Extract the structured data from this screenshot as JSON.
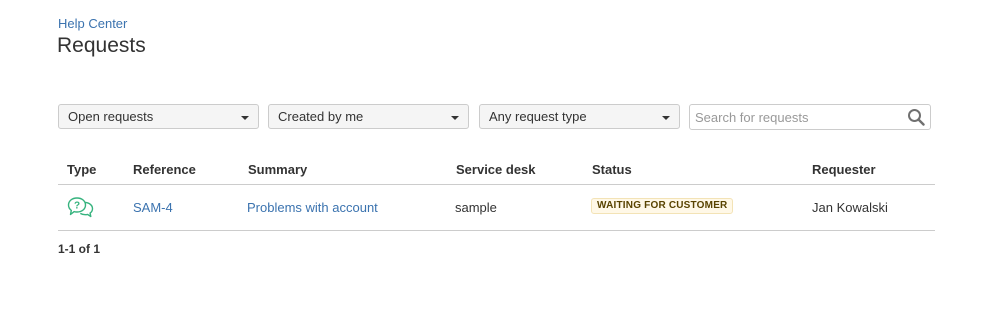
{
  "breadcrumb": {
    "label": "Help Center"
  },
  "page": {
    "title": "Requests"
  },
  "filters": {
    "status": {
      "value": "Open requests"
    },
    "created_by": {
      "value": "Created by me"
    },
    "request_type": {
      "value": "Any request type"
    },
    "search": {
      "placeholder": "Search for requests",
      "value": "",
      "icon": "search-icon"
    }
  },
  "table": {
    "columns": {
      "type": "Type",
      "reference": "Reference",
      "summary": "Summary",
      "service_desk": "Service desk",
      "status": "Status",
      "requester": "Requester"
    },
    "rows": [
      {
        "type_icon": "question-chat-icon",
        "reference": "SAM-4",
        "summary": "Problems with account",
        "service_desk": "sample",
        "status": "WAITING FOR CUSTOMER",
        "requester": "Jan Kowalski"
      }
    ]
  },
  "pagination": {
    "label": "1-1 of 1"
  },
  "colors": {
    "link": "#3b73af",
    "type_icon": "#36b37e",
    "status_bg": "#fff8e7",
    "status_text": "#594300"
  }
}
